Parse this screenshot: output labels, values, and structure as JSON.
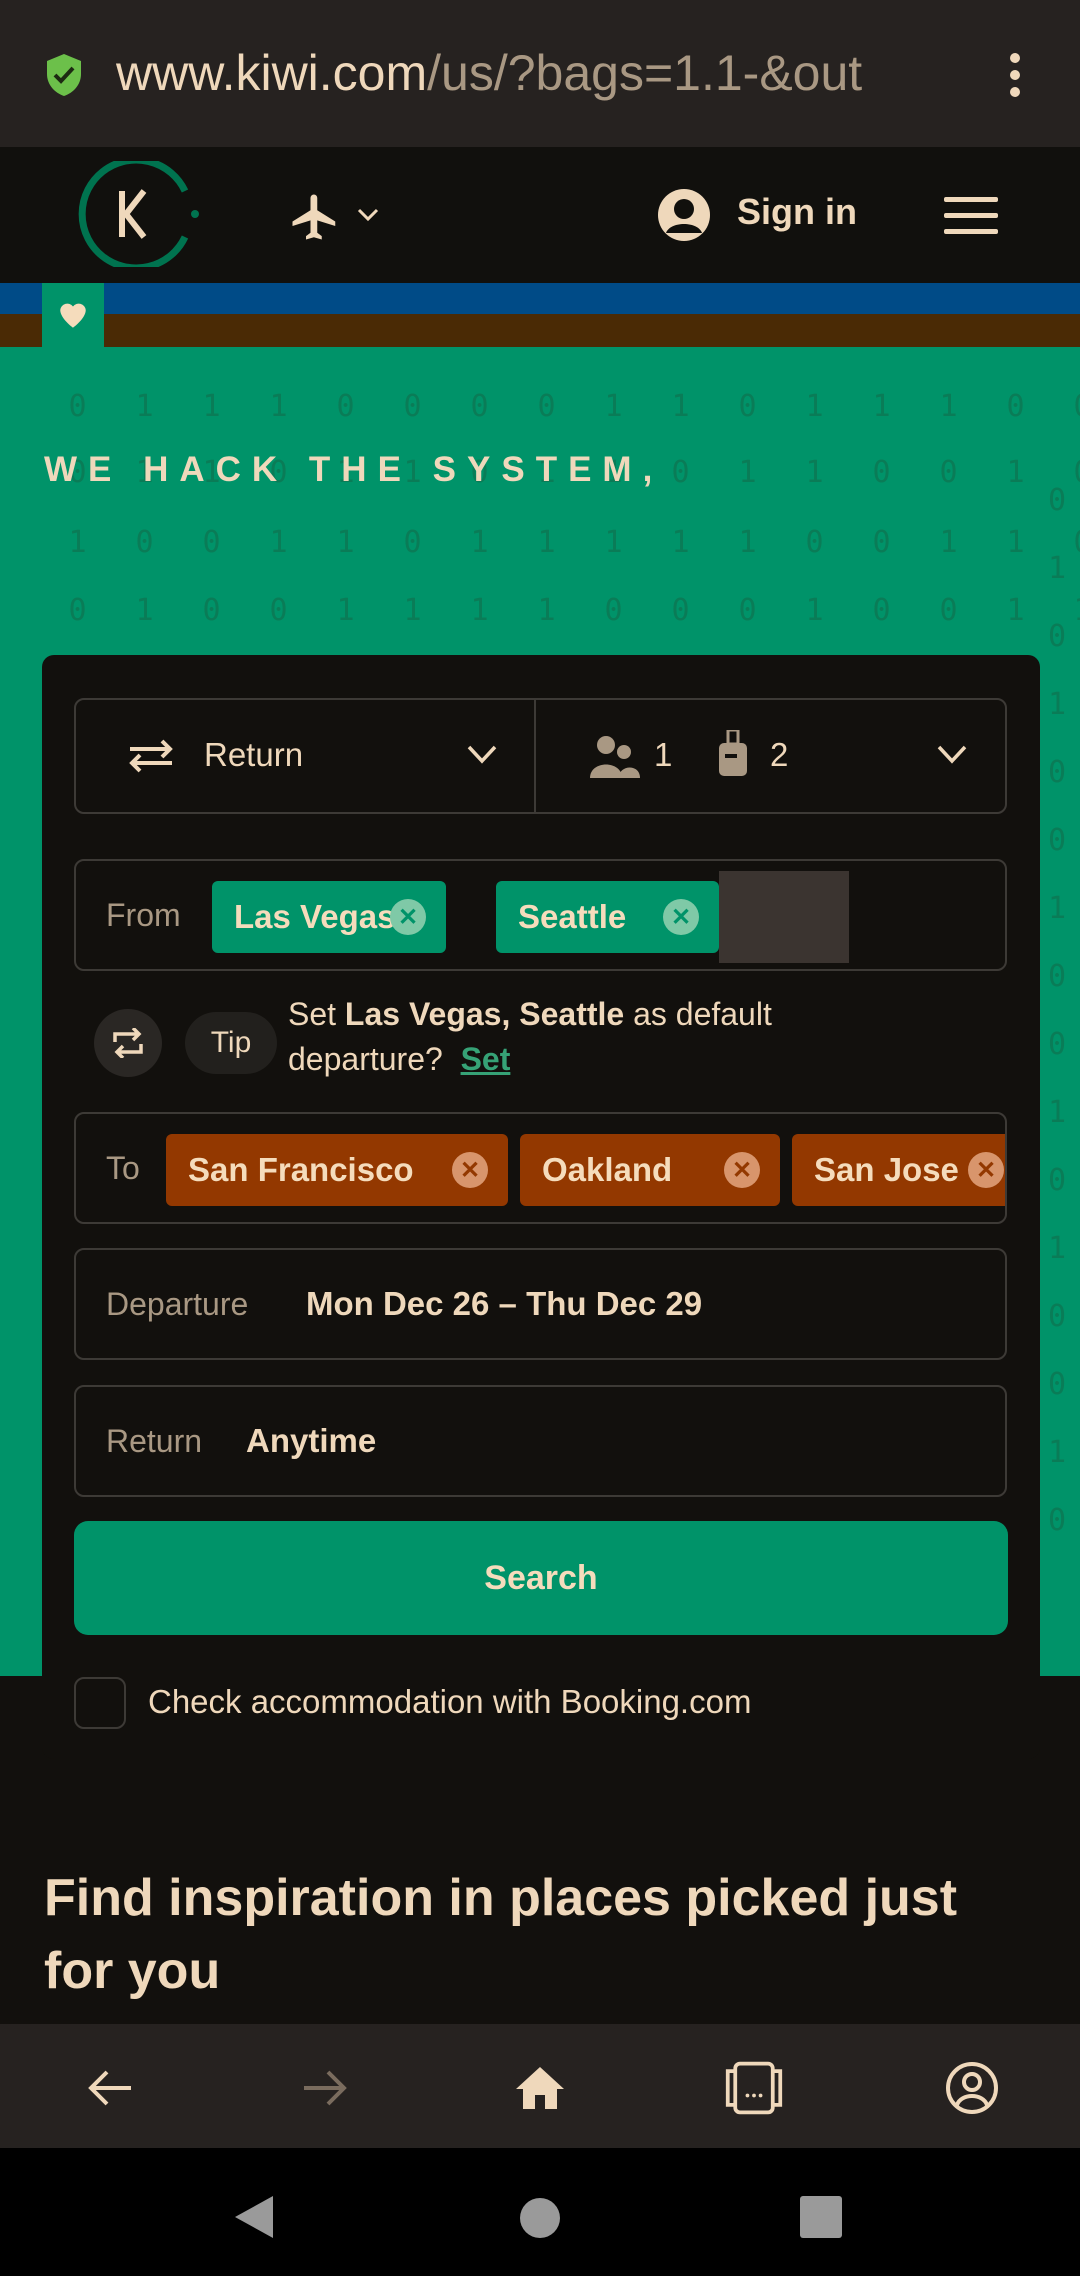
{
  "browser": {
    "url_host": "www.kiwi.com",
    "url_rest": "/us/?bags=1.1-&out"
  },
  "header": {
    "sign_in": "Sign in"
  },
  "hero": {
    "headline": "WE HACK THE SYSTEM,",
    "binary_rows": [
      "0111000011011100",
      "0110110110110010",
      "1001101111100110",
      "0100111100010011"
    ],
    "edge_digits": [
      "0",
      "1",
      "0",
      "1",
      "0",
      "0",
      "1",
      "0",
      "0",
      "1",
      "0",
      "1",
      "0",
      "0",
      "1",
      "0"
    ]
  },
  "search_form": {
    "trip_type": "Return",
    "passengers": "1",
    "bags": "2",
    "from_label": "From",
    "from_places": [
      "Las Vegas",
      "Seattle"
    ],
    "tip_badge": "Tip",
    "tip_text_pre": "Set ",
    "tip_text_places": "Las Vegas, Seattle",
    "tip_text_post": " as default departure?",
    "tip_set_link": "Set",
    "to_label": "To",
    "to_places": [
      "San Francisco",
      "Oakland",
      "San Jose"
    ],
    "departure_label": "Departure",
    "departure_value": "Mon Dec 26 – Thu Dec 29",
    "return_label": "Return",
    "return_value": "Anytime",
    "search_button": "Search",
    "booking_checkbox_label": "Check accommodation with Booking.com",
    "booking_checked": false
  },
  "inspiration": {
    "heading": "Find inspiration in places picked just for you"
  },
  "colors": {
    "brand_green": "#009369",
    "destination_orange": "#933800",
    "text_cream": "#efd8bb"
  }
}
